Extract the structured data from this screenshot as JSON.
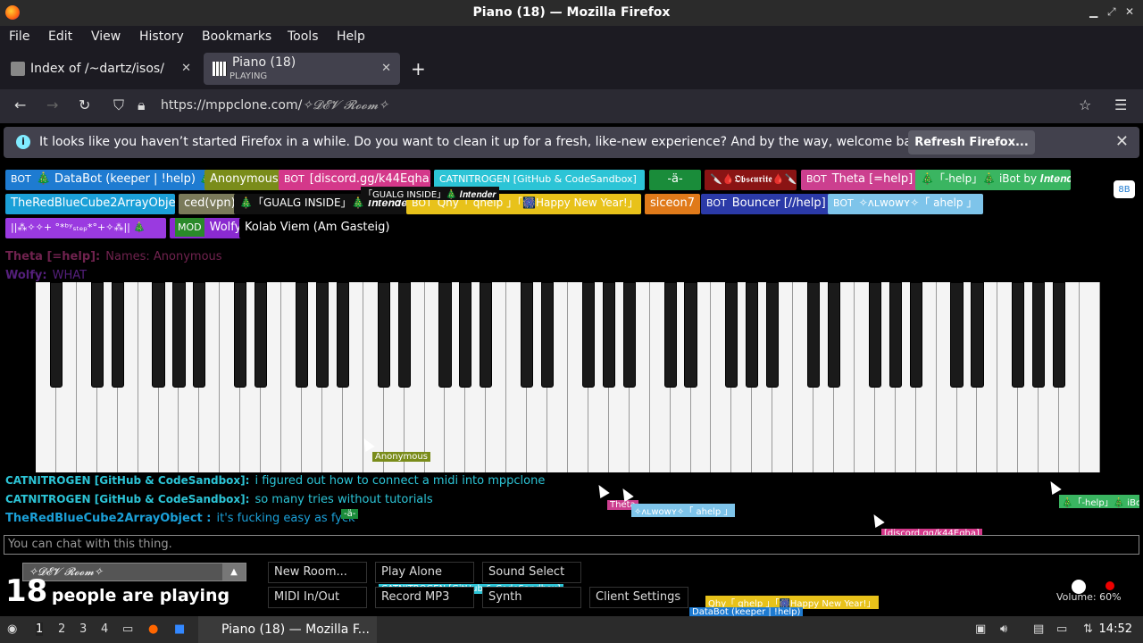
{
  "window": {
    "title": "Piano (18) — Mozilla Firefox"
  },
  "menu": [
    "File",
    "Edit",
    "View",
    "History",
    "Bookmarks",
    "Tools",
    "Help"
  ],
  "tabs": [
    {
      "label": "Index of /~dartz/isos/",
      "sub": ""
    },
    {
      "label": "Piano (18)",
      "sub": "PLAYING"
    }
  ],
  "address": {
    "prefix": "https://mppclone.com/",
    "room": "✧𝓓𝓔𝓥 𝓡𝓸𝓸𝓶✧"
  },
  "notification": {
    "message": "It looks like you haven’t started Firefox in a while. Do you want to clean it up for a fresh, like-new experience? And by the way, welcome back!",
    "button": "Refresh Firefox..."
  },
  "users": [
    {
      "badge": "BOT",
      "name": "🎄 DataBot (keeper | !help) 🎄",
      "color": "#1e7bd1"
    },
    {
      "badge": "",
      "name": "Anonymous",
      "color": "#7a8c1a"
    },
    {
      "badge": "BOT",
      "name": "[discord.gg/k44Eqha]",
      "color": "#d4388a"
    },
    {
      "badge": "",
      "name": "CATNITROGEN [GitHub & CodeSandbox]",
      "color": "#2cc4d6"
    },
    {
      "badge": "",
      "name": "-ä-",
      "color": "#1a8c3a"
    },
    {
      "badge": "",
      "name": "🔪🩸𝕺𝖇𝖘𝖈𝖚𝖗𝖎𝖙𝖊🩸🔪💀",
      "color": "#8a1414"
    },
    {
      "badge": "BOT",
      "name": "Theta [=help]",
      "color": "#cc3f8f"
    },
    {
      "badge": "",
      "name": "🎄「-help」🎄 iBot by 𝑰𝒏𝒕𝒆𝒏𝒅𝒆𝒓",
      "color": "#3ab561"
    },
    {
      "badge": "",
      "name": "TheRedBlueCube2ArrayObject",
      "color": "#1ba0d8"
    },
    {
      "badge": "",
      "name": "ced(vpn)",
      "color": "#7a7a5a"
    },
    {
      "badge": "",
      "name": "🎄「GUALG INSIDE」🎄 𝑰𝒏𝒕𝒆𝒏𝒅𝒆𝒓",
      "color": "#111111"
    },
    {
      "badge": "BOT",
      "name": "Qhy「 qhelp 」「🎆Happy New Year!」",
      "color": "#e8c21a"
    },
    {
      "badge": "",
      "name": "siceon7",
      "color": "#e07a1a"
    },
    {
      "badge": "BOT",
      "name": "Bouncer [//help]",
      "color": "#2b3aa8"
    },
    {
      "badge": "BOT",
      "name": "✧ᴧʟᴡᴏᴡʏ✧「 ahelp 」",
      "color": "#7ec4ea"
    },
    {
      "badge": "",
      "name": "||⁂✧✧+ °*ᵇʸₛₜₑₚ*°+✧⁂|| 🎄",
      "color": "#9a3ae0"
    },
    {
      "badge": "MOD",
      "name": "Wolfy",
      "color": "#8a2ad0"
    },
    {
      "badge": "",
      "name": "Kolab Viem (Am Gasteig)",
      "color": "#000000"
    }
  ],
  "chat_bg": [
    {
      "name": "Theta [=help]:",
      "text": "Names: Anonymous",
      "color": "#7a2050"
    },
    {
      "name": "Wolfy:",
      "text": "WHAT",
      "color": "#6a2aa0"
    }
  ],
  "chat": [
    {
      "name": "CATNITROGEN [GitHub & CodeSandbox]:",
      "text": "i figured out how to connect a midi into mppclone",
      "color": "#2cc4d6"
    },
    {
      "name": "CATNITROGEN [GitHub & CodeSandbox]:",
      "text": "so many tries without tutorials",
      "color": "#2cc4d6"
    },
    {
      "name": "TheRedBlueCube2ArrayObject :",
      "text": "it's fucking easy as fyck",
      "color": "#1ba0d8"
    }
  ],
  "chat_input_placeholder": "You can chat with this thing.",
  "room_select": "✧𝓓𝓔𝓥 𝓡𝓸𝓸𝓶✧",
  "people_count": "18",
  "people_label": "people are playing",
  "buttons": {
    "new_room": "New Room...",
    "play_alone": "Play Alone",
    "sound_select": "Sound Select",
    "midi": "MIDI In/Out",
    "record": "Record MP3",
    "synth": "Synth",
    "client_settings": "Client Settings"
  },
  "volume": {
    "label": "Volume: 60%",
    "level": 0.6
  },
  "cursor_tags": [
    {
      "text": "Anonymous",
      "color": "#7a8c1a"
    },
    {
      "text": "Theta",
      "color": "#cc3f8f"
    },
    {
      "text": "✧ᴧʟᴡᴏᴡʏ✧「 ahelp 」",
      "color": "#7ec4ea"
    },
    {
      "text": "[discord.gg/k44Eqha]",
      "color": "#d4388a"
    },
    {
      "text": "🎄「-help」🎄 iBot b",
      "color": "#3ab561"
    },
    {
      "text": "CATNITROGEN [GitHub & CodeSandbox]",
      "color": "#2cc4d6"
    },
    {
      "text": "Qhy「 qhelp 」「🎆Happy New Year!」",
      "color": "#e8c21a"
    },
    {
      "text": "DataBot (keeper | !help)",
      "color": "#1e7bd1"
    },
    {
      "text": "-ä-",
      "color": "#1a8c3a"
    },
    {
      "text": "「GUALG INSIDE」🎄 𝑰𝒏𝒕𝒆𝒏𝒅𝒆𝒓",
      "color": "#111111"
    }
  ],
  "taskbar": {
    "workspaces": [
      "1",
      "2",
      "3",
      "4"
    ],
    "task": "Piano (18) — Mozilla F...",
    "clock": "14:52"
  }
}
